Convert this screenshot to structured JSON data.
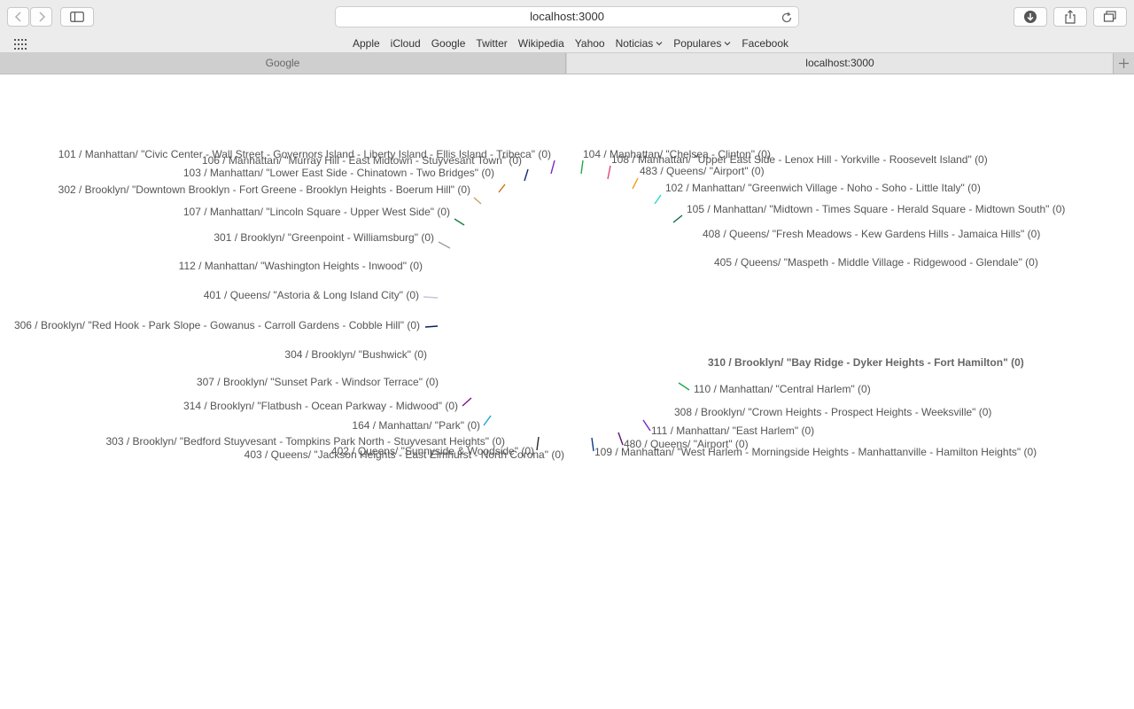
{
  "browser": {
    "url": "localhost:3000",
    "favorites": [
      {
        "label": "Apple",
        "menu": false
      },
      {
        "label": "iCloud",
        "menu": false
      },
      {
        "label": "Google",
        "menu": false
      },
      {
        "label": "Twitter",
        "menu": false
      },
      {
        "label": "Wikipedia",
        "menu": false
      },
      {
        "label": "Yahoo",
        "menu": false
      },
      {
        "label": "Noticias",
        "menu": true
      },
      {
        "label": "Populares",
        "menu": true
      },
      {
        "label": "Facebook",
        "menu": false
      }
    ],
    "tabs": [
      {
        "label": "Google",
        "active": false
      },
      {
        "label": "localhost:3000",
        "active": true
      }
    ]
  },
  "chart_data": {
    "type": "radial",
    "left_labels": [
      "101 / Manhattan/ \"Civic Center - Wall Street - Governors Island - Liberty Island - Ellis Island - Tribeca\" (0)",
      "106 / Manhattan/ \"Murray Hill - East Midtown - Stuyvesant Town\" (0)",
      "103 / Manhattan/ \"Lower East Side - Chinatown - Two Bridges\" (0)",
      "302 / Brooklyn/ \"Downtown Brooklyn - Fort Greene - Brooklyn Heights - Boerum Hill\" (0)",
      "107 / Manhattan/ \"Lincoln Square - Upper West Side\" (0)",
      "301 / Brooklyn/ \"Greenpoint - Williamsburg\" (0)",
      "112 / Manhattan/ \"Washington Heights - Inwood\" (0)",
      "401 / Queens/ \"Astoria & Long Island City\" (0)",
      "306 / Brooklyn/ \"Red Hook - Park Slope - Gowanus - Carroll Gardens - Cobble Hill\" (0)",
      "304 / Brooklyn/ \"Bushwick\" (0)",
      "307 / Brooklyn/ \"Sunset Park - Windsor Terrace\" (0)",
      "314 / Brooklyn/ \"Flatbush - Ocean Parkway - Midwood\" (0)",
      "164 / Manhattan/ \"Park\" (0)",
      "303 / Brooklyn/ \"Bedford Stuyvesant - Tompkins Park North - Stuyvesant Heights\" (0)",
      "402 / Queens/ \"Sunnyside & Woodside\" (0)",
      "403 / Queens/ \"Jackson Heights - East Elmhurst - North Corona\" (0)"
    ],
    "right_labels": [
      "104 / Manhattan/ \"Chelsea - Clinton\" (0)",
      "108 / Manhattan/ \"Upper East Side - Lenox Hill - Yorkville - Roosevelt Island\" (0)",
      "483 / Queens/ \"Airport\" (0)",
      "102 / Manhattan/ \"Greenwich Village - Noho - Soho - Little Italy\" (0)",
      "105 / Manhattan/ \"Midtown - Times Square - Herald Square - Midtown South\" (0)",
      "408 / Queens/ \"Fresh Meadows - Kew Gardens Hills - Jamaica Hills\" (0)",
      "405 / Queens/ \"Maspeth - Middle Village - Ridgewood - Glendale\" (0)",
      "310 / Brooklyn/ \"Bay Ridge - Dyker Heights - Fort Hamilton\" (0)",
      "110 / Manhattan/ \"Central Harlem\" (0)",
      "308 / Brooklyn/ \"Crown Heights - Prospect Heights - Weeksville\" (0)",
      "111 / Manhattan/ \"East Harlem\" (0)",
      "480 / Queens/ \"Airport\" (0)",
      "109 / Manhattan/ \"West Harlem - Morningside Heights - Manhattanville - Hamilton Heights\" (0)"
    ],
    "highlighted": "310 / Brooklyn/ \"Bay Ridge - Dyker Heights - Fort Hamilton\" (0)",
    "colors": [
      "#7b22c7",
      "#1fa84a",
      "#e0457a",
      "#0d2c6b",
      "#f0a020",
      "#c9700e",
      "#2fd6c6",
      "#c8a060",
      "#0b6b4a",
      "#178040",
      "#9aa0a8",
      "#c0c8d8",
      "#0a1f5c",
      "#8a0a8a",
      "#1aa4d6",
      "#2a2a2a",
      "#0a3a8a",
      "#5a1070"
    ]
  }
}
